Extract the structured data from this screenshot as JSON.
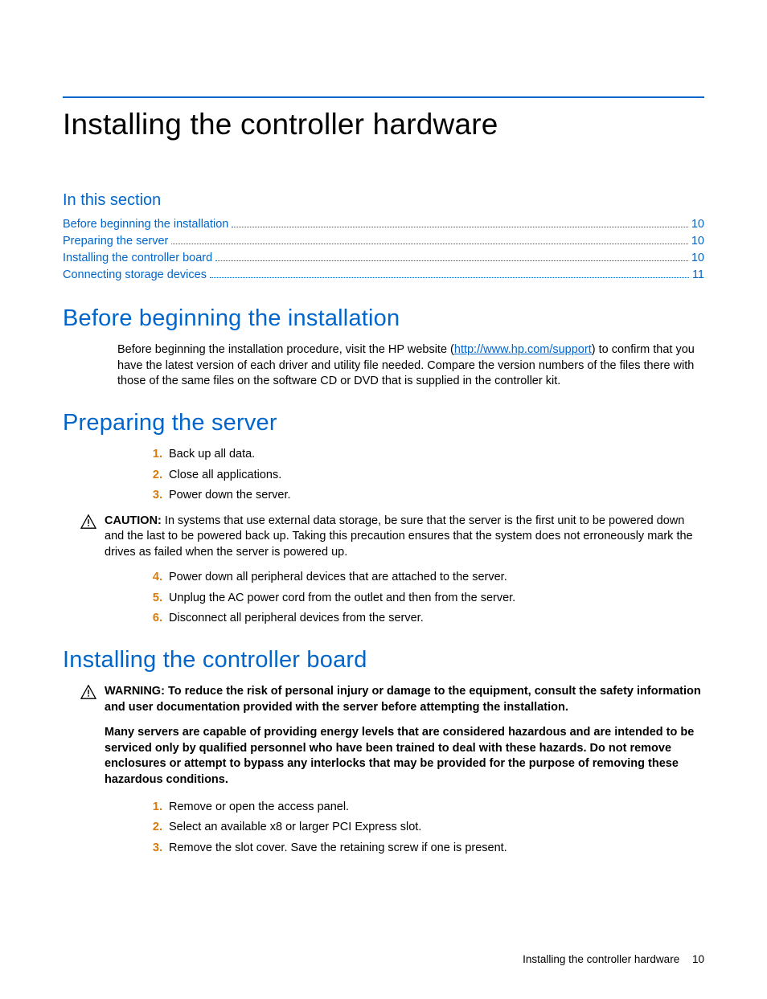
{
  "page_title": "Installing the controller hardware",
  "in_this_section_label": "In this section",
  "toc": [
    {
      "label": "Before beginning the installation",
      "page": "10"
    },
    {
      "label": "Preparing the server",
      "page": "10"
    },
    {
      "label": "Installing the controller board",
      "page": "10"
    },
    {
      "label": "Connecting storage devices",
      "page": "11"
    }
  ],
  "sec_before": {
    "heading": "Before beginning the installation",
    "para_prefix": "Before beginning the installation procedure, visit the HP website (",
    "link_text": "http://www.hp.com/support",
    "para_suffix": ") to confirm that you have the latest version of each driver and utility file needed. Compare the version numbers of the files there with those of the same files on the software CD or DVD that is supplied in the controller kit."
  },
  "sec_prep": {
    "heading": "Preparing the server",
    "steps_a": [
      "Back up all data.",
      "Close all applications.",
      "Power down the server."
    ],
    "caution_label": "CAUTION:",
    "caution_text": "In systems that use external data storage, be sure that the server is the first unit to be powered down and the last to be powered back up. Taking this precaution ensures that the system does not erroneously mark the drives as failed when the server is powered up.",
    "steps_b": [
      "Power down all peripheral devices that are attached to the server.",
      "Unplug the AC power cord from the outlet and then from the server.",
      "Disconnect all peripheral devices from the server."
    ]
  },
  "sec_board": {
    "heading": "Installing the controller board",
    "warning_label": "WARNING:",
    "warning_text": "To reduce the risk of personal injury or damage to the equipment, consult the safety information and user documentation provided with the server before attempting the installation.",
    "warning_para": "Many servers are capable of providing energy levels that are considered hazardous and are intended to be serviced only by qualified personnel who have been trained to deal with these hazards. Do not remove enclosures or attempt to bypass any interlocks that may be provided for the purpose of removing these hazardous conditions.",
    "steps": [
      "Remove or open the access panel.",
      "Select an available x8 or larger PCI Express slot.",
      "Remove the slot cover. Save the retaining screw if one is present."
    ]
  },
  "footer": {
    "text": "Installing the controller hardware",
    "page": "10"
  }
}
